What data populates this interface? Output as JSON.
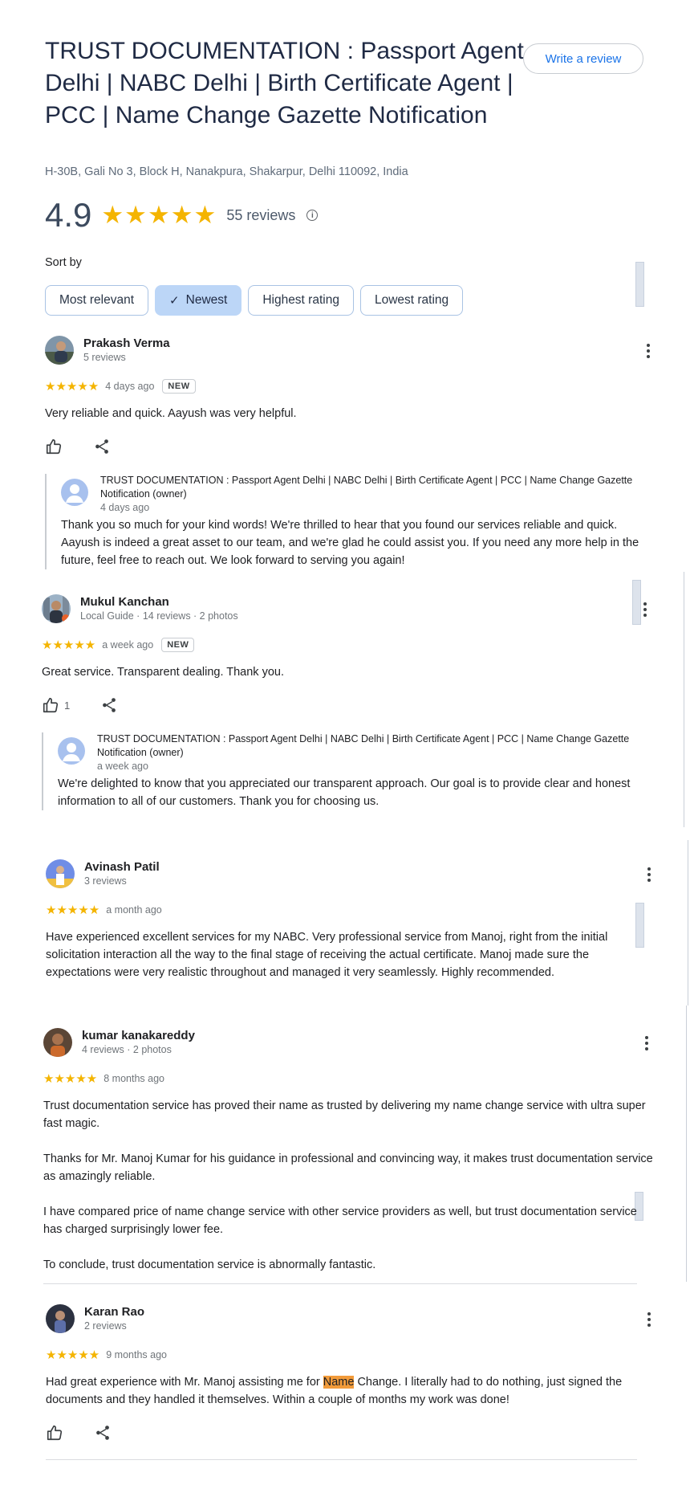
{
  "header": {
    "title": "TRUST DOCUMENTATION : Passport Agent Delhi | NABC Delhi | Birth Certificate Agent | PCC | Name Change Gazette Notification",
    "address": "H-30B, Gali No 3, Block H, Nanakpura, Shakarpur, Delhi 110092, India",
    "write_review_label": "Write a review",
    "rating": "4.9",
    "stars": "★★★★★",
    "review_count": "55 reviews",
    "info_glyph": "i"
  },
  "sort": {
    "label": "Sort by",
    "options": [
      "Most relevant",
      "Newest",
      "Highest rating",
      "Lowest rating"
    ],
    "selected": "Newest",
    "check_glyph": "✓"
  },
  "owner_name": "TRUST DOCUMENTATION : Passport Agent Delhi | NABC Delhi | Birth Certificate Agent | PCC | Name Change Gazette Notification (owner)",
  "reviews": [
    {
      "name": "Prakash Verma",
      "meta": "5 reviews",
      "stars": "★★★★★",
      "when": "4 days ago",
      "badge": "NEW",
      "text": "Very reliable and quick. Aayush was very helpful.",
      "likes": "",
      "reply": {
        "when": "4 days ago",
        "text": "Thank you so much for your kind words! We're thrilled to hear that you found our services reliable and quick. Aayush is indeed a great asset to our team, and we're glad he could assist you. If you need any more help in the future, feel free to reach out. We look forward to serving you again!"
      }
    },
    {
      "name": "Mukul Kanchan",
      "meta": "Local Guide · 14 reviews · 2 photos",
      "stars": "★★★★★",
      "when": "a week ago",
      "badge": "NEW",
      "text": "Great service. Transparent dealing. Thank you.",
      "likes": "1",
      "reply": {
        "when": "a week ago",
        "text": "We're delighted to know that you appreciated our transparent approach. Our goal is to provide clear and honest information to all of our customers. Thank you for choosing us."
      }
    },
    {
      "name": "Avinash Patil",
      "meta": "3 reviews",
      "stars": "★★★★★",
      "when": "a month ago",
      "text": "Have experienced excellent services for my NABC. Very professional service from Manoj, right from the initial solicitation interaction all the way to the final stage of receiving the actual certificate. Manoj made sure the expectations were very realistic throughout and managed it very seamlessly. Highly recommended."
    },
    {
      "name": "kumar kanakareddy",
      "meta": "4 reviews · 2 photos",
      "stars": "★★★★★",
      "when": "8 months ago",
      "text": "Trust documentation service has proved their name as trusted by delivering my name change service with ultra super fast magic.\n\nThanks for Mr. Manoj Kumar for his guidance in professional and convincing way, it makes trust documentation service as amazingly reliable.\n\nI have compared price of name change service with other service providers as well, but trust documentation service has charged surprisingly lower fee.\n\nTo conclude, trust documentation service is abnormally fantastic."
    },
    {
      "name": "Karan Rao",
      "meta": "2 reviews",
      "stars": "★★★★★",
      "when": "9 months ago",
      "text_before": "Had great experience with Mr. Manoj assisting me for ",
      "text_highlight": "Name",
      "text_after": " Change. I literally had to do nothing, just signed the documents and they handled it themselves. Within a couple of months my work was done!",
      "likes": ""
    }
  ],
  "colors": {
    "accent": "#1a73e8",
    "star": "#f4b400",
    "chip_active": "#bcd6f7",
    "highlight": "#f29b3a"
  },
  "icons": [
    "info-icon",
    "check-icon",
    "thumbs-up-icon",
    "share-icon",
    "more-vert-icon",
    "avatar-icon"
  ]
}
